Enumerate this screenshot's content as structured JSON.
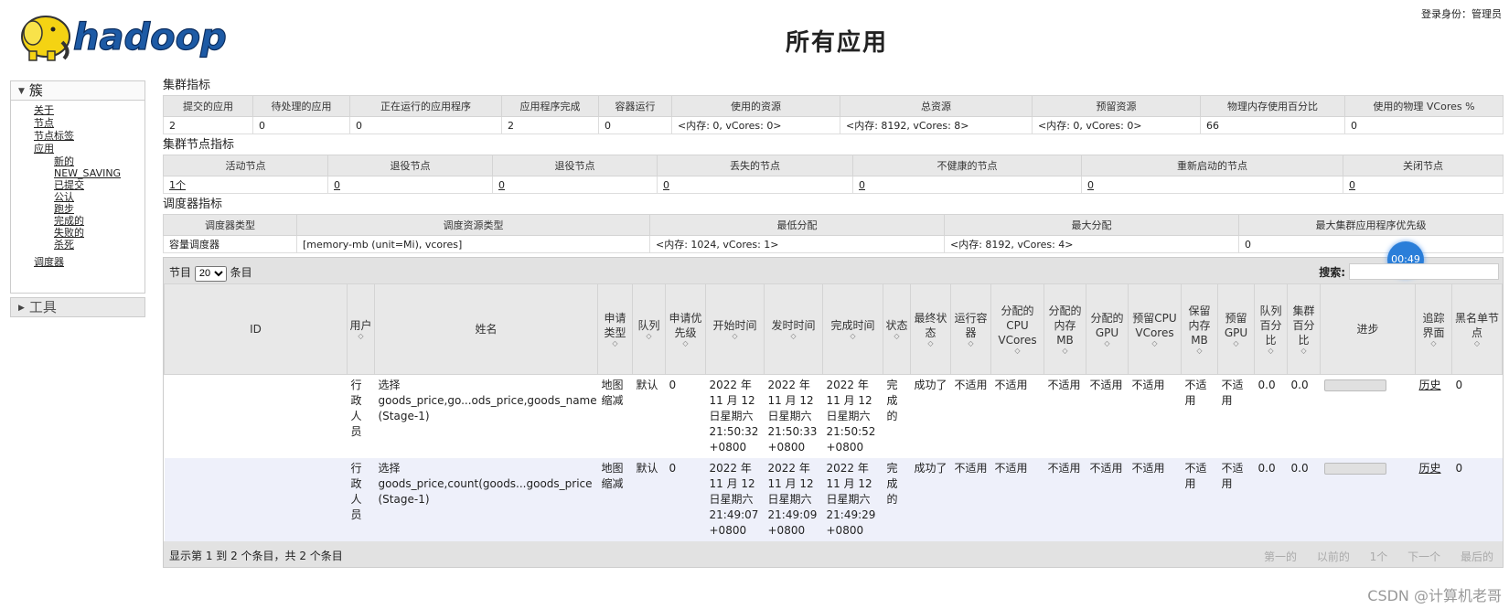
{
  "header": {
    "logo_text": "hadoop",
    "page_title": "所有应用",
    "login": "登录身份：管理员"
  },
  "sidebar": {
    "cluster_label": "簇",
    "items": [
      {
        "label": "关于"
      },
      {
        "label": "节点"
      },
      {
        "label": "节点标签"
      },
      {
        "label": "应用"
      }
    ],
    "app_states": [
      "新的",
      "NEW_SAVING",
      "已提交",
      "公认",
      "跑步",
      "完成的",
      "失败的",
      "杀死"
    ],
    "scheduler": "调度器",
    "tools_label": "工具"
  },
  "cluster_metrics": {
    "title": "集群指标",
    "headers": [
      "提交的应用",
      "待处理的应用",
      "正在运行的应用程序",
      "应用程序完成",
      "容器运行",
      "使用的资源",
      "总资源",
      "预留资源",
      "物理内存使用百分比",
      "使用的物理 VCores %"
    ],
    "values": [
      "2",
      "0",
      "0",
      "2",
      "0",
      "<内存: 0, vCores: 0>",
      "<内存: 8192, vCores: 8>",
      "<内存: 0, vCores: 0>",
      "66",
      "0"
    ]
  },
  "node_metrics": {
    "title": "集群节点指标",
    "headers": [
      "活动节点",
      "退役节点",
      "退役节点",
      "丢失的节点",
      "不健康的节点",
      "重新启动的节点",
      "关闭节点"
    ],
    "values": [
      "1个",
      "0",
      "0",
      "0",
      "0",
      "0",
      "0"
    ]
  },
  "scheduler_metrics": {
    "title": "调度器指标",
    "headers": [
      "调度器类型",
      "调度资源类型",
      "最低分配",
      "最大分配",
      "最大集群应用程序优先级"
    ],
    "values": [
      "容量调度器",
      "[memory-mb (unit=Mi), vcores]",
      "<内存: 1024, vCores: 1>",
      "<内存: 8192, vCores: 4>",
      "0"
    ]
  },
  "apps": {
    "length_prefix": "节目",
    "length_value": "20",
    "length_suffix": "条目",
    "search_label": "搜索:",
    "search_value": "",
    "timer": "00:49",
    "headers": [
      "ID",
      "用户",
      "姓名",
      "申请类型",
      "队列",
      "申请优先级",
      "开始时间",
      "发时时间",
      "完成时间",
      "状态",
      "最终状态",
      "运行容器",
      "分配的CPU VCores",
      "分配的内存MB",
      "分配的GPU",
      "预留CPU VCores",
      "保留内存MB",
      "预留GPU",
      "队列百分比",
      "集群百分比",
      "进步",
      "追踪界面",
      "黑名单节点"
    ],
    "rows": [
      {
        "id": "",
        "user": "行政人员",
        "name": "选择 goods_price,go...ods_price,goods_name (Stage-1)",
        "type": "地图缩减",
        "queue": "默认",
        "priority": "0",
        "start": "2022 年 11 月 12 日星期六 21:50:32 +0800",
        "launch": "2022 年 11 月 12 日星期六 21:50:33 +0800",
        "finish": "2022 年 11 月 12 日星期六 21:50:52 +0800",
        "state": "完成的",
        "final": "成功了",
        "containers": "不适用",
        "cpu": "不适用",
        "mem": "不适用",
        "gpu": "不适用",
        "rcpu": "不适用",
        "rmem": "不适用",
        "rgpu": "不适用",
        "qpct": "0.0",
        "cpct": "0.0",
        "progress": 0,
        "track": "历史",
        "blacklist": "0"
      },
      {
        "id": "",
        "user": "行政人员",
        "name": "选择 goods_price,count(goods...goods_price (Stage-1)",
        "type": "地图缩减",
        "queue": "默认",
        "priority": "0",
        "start": "2022 年 11 月 12 日星期六 21:49:07 +0800",
        "launch": "2022 年 11 月 12 日星期六 21:49:09 +0800",
        "finish": "2022 年 11 月 12 日星期六 21:49:29 +0800",
        "state": "完成的",
        "final": "成功了",
        "containers": "不适用",
        "cpu": "不适用",
        "mem": "不适用",
        "gpu": "不适用",
        "rcpu": "不适用",
        "rmem": "不适用",
        "rgpu": "不适用",
        "qpct": "0.0",
        "cpct": "0.0",
        "progress": 0,
        "track": "历史",
        "blacklist": "0"
      }
    ],
    "info": "显示第 1 到 2 个条目，共 2 个条目",
    "pager": [
      "第一的",
      "以前的",
      "1个",
      "下一个",
      "最后的"
    ]
  },
  "watermark": "CSDN @计算机老哥"
}
